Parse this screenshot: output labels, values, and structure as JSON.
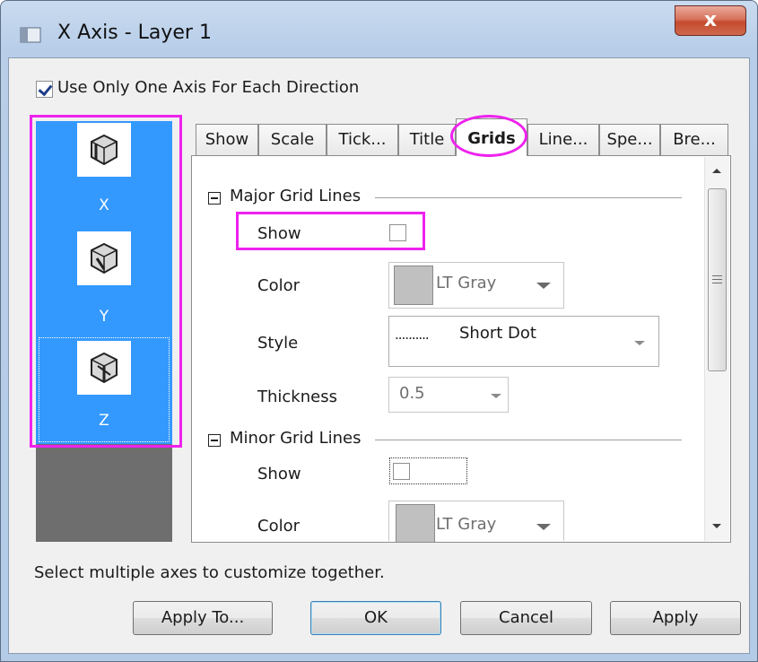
{
  "window": {
    "title": "X Axis - Layer 1",
    "close_label": "x"
  },
  "use_one_axis": {
    "label": "Use Only One Axis For Each Direction",
    "checked": true
  },
  "axes": [
    {
      "label": "X",
      "icon": "3d-axis-x-icon"
    },
    {
      "label": "Y",
      "icon": "3d-axis-y-icon"
    },
    {
      "label": "Z",
      "icon": "3d-axis-z-icon"
    }
  ],
  "tabs": [
    {
      "label": "Show"
    },
    {
      "label": "Scale"
    },
    {
      "label": "Tick..."
    },
    {
      "label": "Title"
    },
    {
      "label": "Grids",
      "active": true
    },
    {
      "label": "Line..."
    },
    {
      "label": "Spe..."
    },
    {
      "label": "Bre..."
    }
  ],
  "major": {
    "title": "Major Grid Lines",
    "show_label": "Show",
    "show_checked": false,
    "color_label": "Color",
    "color_value": "LT Gray",
    "style_label": "Style",
    "style_value": "Short Dot",
    "style_preview": "..........",
    "thickness_label": "Thickness",
    "thickness_value": "0.5"
  },
  "minor": {
    "title": "Minor Grid Lines",
    "show_label": "Show",
    "show_checked": false,
    "color_label": "Color",
    "color_value": "LT Gray"
  },
  "hint": "Select multiple axes to customize together.",
  "buttons": {
    "apply_to": "Apply To...",
    "ok": "OK",
    "cancel": "Cancel",
    "apply": "Apply"
  },
  "colors": {
    "selection": "#3399ff",
    "highlight": "#ee22ee",
    "swatch_lt_gray": "#c0c0c0"
  }
}
